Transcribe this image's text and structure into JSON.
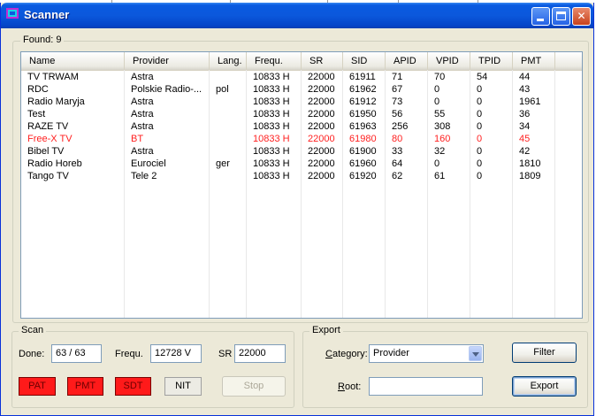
{
  "window": {
    "title": "Scanner",
    "icon": "scanner-app-icon"
  },
  "results": {
    "found_label": "Found:",
    "found_count": "9",
    "columns": [
      "Name",
      "Provider",
      "Lang.",
      "Frequ.",
      "SR",
      "SID",
      "APID",
      "VPID",
      "TPID",
      "PMT"
    ],
    "rows": [
      {
        "name": "TV TRWAM",
        "provider": "Astra",
        "lang": "",
        "freq": "10833 H",
        "sr": "22000",
        "sid": "61911",
        "apid": "71",
        "vpid": "70",
        "tpid": "54",
        "pmt": "44",
        "highlight": false
      },
      {
        "name": "RDC",
        "provider": "Polskie Radio-...",
        "lang": "pol",
        "freq": "10833 H",
        "sr": "22000",
        "sid": "61962",
        "apid": "67",
        "vpid": "0",
        "tpid": "0",
        "pmt": "43",
        "highlight": false
      },
      {
        "name": "Radio Maryja",
        "provider": "Astra",
        "lang": "",
        "freq": "10833 H",
        "sr": "22000",
        "sid": "61912",
        "apid": "73",
        "vpid": "0",
        "tpid": "0",
        "pmt": "1961",
        "highlight": false
      },
      {
        "name": "Test",
        "provider": "Astra",
        "lang": "",
        "freq": "10833 H",
        "sr": "22000",
        "sid": "61950",
        "apid": "56",
        "vpid": "55",
        "tpid": "0",
        "pmt": "36",
        "highlight": false
      },
      {
        "name": "RAZE TV",
        "provider": "Astra",
        "lang": "",
        "freq": "10833 H",
        "sr": "22000",
        "sid": "61963",
        "apid": "256",
        "vpid": "308",
        "tpid": "0",
        "pmt": "34",
        "highlight": false
      },
      {
        "name": "Free-X TV",
        "provider": "BT",
        "lang": "",
        "freq": "10833 H",
        "sr": "22000",
        "sid": "61980",
        "apid": "80",
        "vpid": "160",
        "tpid": "0",
        "pmt": "45",
        "highlight": true
      },
      {
        "name": "Bibel TV",
        "provider": "Astra",
        "lang": "",
        "freq": "10833 H",
        "sr": "22000",
        "sid": "61900",
        "apid": "33",
        "vpid": "32",
        "tpid": "0",
        "pmt": "42",
        "highlight": false
      },
      {
        "name": "Radio Horeb",
        "provider": "Eurociel",
        "lang": "ger",
        "freq": "10833 H",
        "sr": "22000",
        "sid": "61960",
        "apid": "64",
        "vpid": "0",
        "tpid": "0",
        "pmt": "1810",
        "highlight": false
      },
      {
        "name": "Tango TV",
        "provider": "Tele 2",
        "lang": "",
        "freq": "10833 H",
        "sr": "22000",
        "sid": "61920",
        "apid": "62",
        "vpid": "61",
        "tpid": "0",
        "pmt": "1809",
        "highlight": false
      }
    ]
  },
  "scan": {
    "group_label": "Scan",
    "done_label": "Done:",
    "done_value": "63 / 63",
    "freq_label": "Frequ.",
    "freq_value": "12728 V",
    "sr_label": "SR",
    "sr_value": "22000",
    "flags": [
      {
        "label": "PAT",
        "active": true
      },
      {
        "label": "PMT",
        "active": true
      },
      {
        "label": "SDT",
        "active": true
      },
      {
        "label": "NIT",
        "active": false
      }
    ],
    "stop_label": "Stop"
  },
  "export": {
    "group_label": "Export",
    "category_label": "Category:",
    "category_value": "Provider",
    "root_label": "Root:",
    "root_value": "",
    "filter_label": "Filter",
    "export_label": "Export"
  },
  "colors": {
    "highlight_row_text": "#ff1f1f",
    "flag_active": "#ff1a1a",
    "title_bar": "#0a5ae0"
  }
}
